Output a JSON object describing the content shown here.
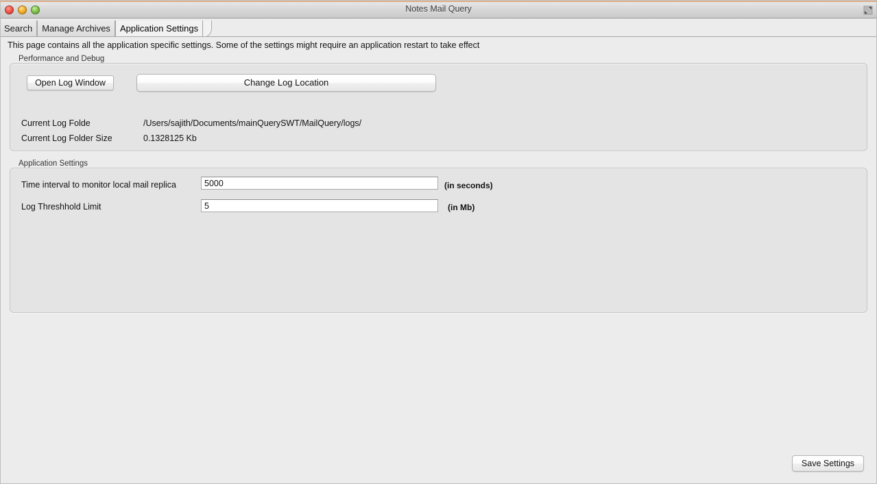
{
  "window": {
    "title": "Notes Mail Query",
    "controls": {
      "close": "close-button",
      "minimize": "minimize-button",
      "maximize": "maximize-button",
      "fullscreen": "fullscreen-button"
    }
  },
  "tabs": [
    {
      "label": "Search",
      "active": false
    },
    {
      "label": "Manage Archives",
      "active": false
    },
    {
      "label": "Application Settings",
      "active": true
    }
  ],
  "page": {
    "description": "This page contains all the application specific settings. Some of the settings might require an application restart to take effect"
  },
  "groups": {
    "performance": {
      "label": "Performance and Debug",
      "buttons": {
        "open_log_window": "Open Log Window",
        "change_log_location": "Change Log Location"
      },
      "fields": [
        {
          "label": "Current Log Folde",
          "value": "/Users/sajith/Documents/mainQuerySWT/MailQuery/logs/"
        },
        {
          "label": "Current Log Folder Size",
          "value": "0.1328125 Kb"
        }
      ]
    },
    "application_settings": {
      "label": "Application Settings",
      "fields": [
        {
          "label": "Time interval to monitor local mail replica",
          "value": "5000",
          "suffix": "(in seconds)"
        },
        {
          "label": "Log Threshhold Limit",
          "value": "5",
          "suffix": "(in Mb)"
        }
      ]
    }
  },
  "footer": {
    "save_button": "Save Settings"
  },
  "colors": {
    "window_background": "#ececec",
    "group_background": "#e4e4e4",
    "group_border": "#c4c4c4",
    "titlebar_top_strip": "#d9a882",
    "text": "#111111",
    "input_background": "#ffffff"
  }
}
